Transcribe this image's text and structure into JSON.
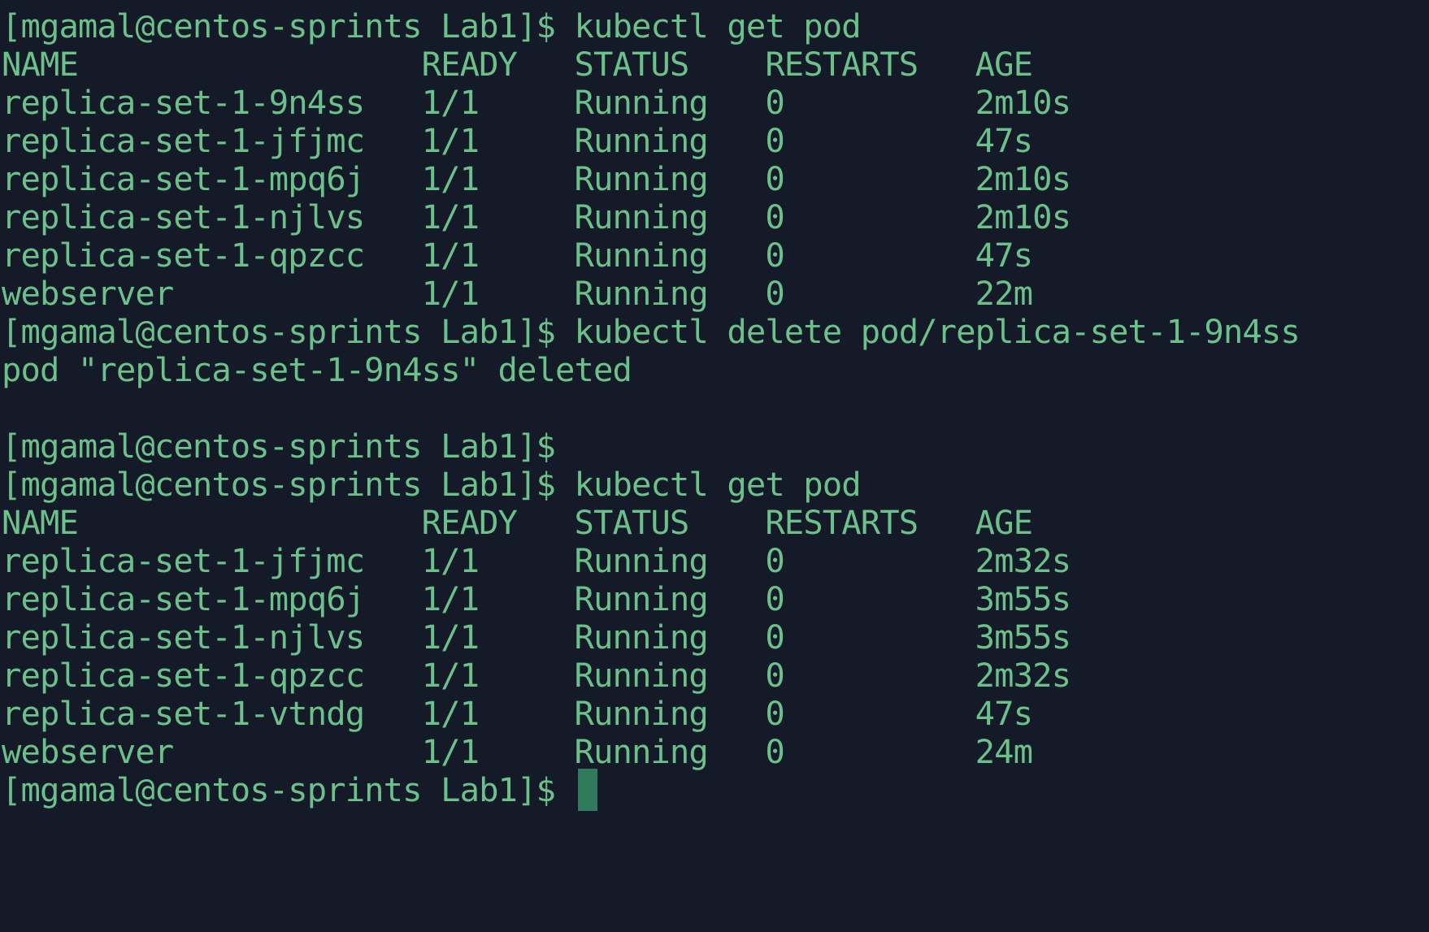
{
  "theme": {
    "background": "#141a28",
    "foreground": "#6cc089",
    "cursor": "#2f7a5a"
  },
  "terminal": {
    "lines": [
      "[mgamal@centos-sprints Lab1]$ kubectl get pod",
      "NAME                  READY   STATUS    RESTARTS   AGE",
      "replica-set-1-9n4ss   1/1     Running   0          2m10s",
      "replica-set-1-jfjmc   1/1     Running   0          47s",
      "replica-set-1-mpq6j   1/1     Running   0          2m10s",
      "replica-set-1-njlvs   1/1     Running   0          2m10s",
      "replica-set-1-qpzcc   1/1     Running   0          47s",
      "webserver             1/1     Running   0          22m",
      "[mgamal@centos-sprints Lab1]$ kubectl delete pod/replica-set-1-9n4ss",
      "pod \"replica-set-1-9n4ss\" deleted",
      "",
      "[mgamal@centos-sprints Lab1]$",
      "[mgamal@centos-sprints Lab1]$ kubectl get pod",
      "NAME                  READY   STATUS    RESTARTS   AGE",
      "replica-set-1-jfjmc   1/1     Running   0          2m32s",
      "replica-set-1-mpq6j   1/1     Running   0          3m55s",
      "replica-set-1-njlvs   1/1     Running   0          3m55s",
      "replica-set-1-qpzcc   1/1     Running   0          2m32s",
      "replica-set-1-vtndg   1/1     Running   0          47s",
      "webserver             1/1     Running   0          24m"
    ],
    "prompt": "[mgamal@centos-sprints Lab1]$ "
  }
}
